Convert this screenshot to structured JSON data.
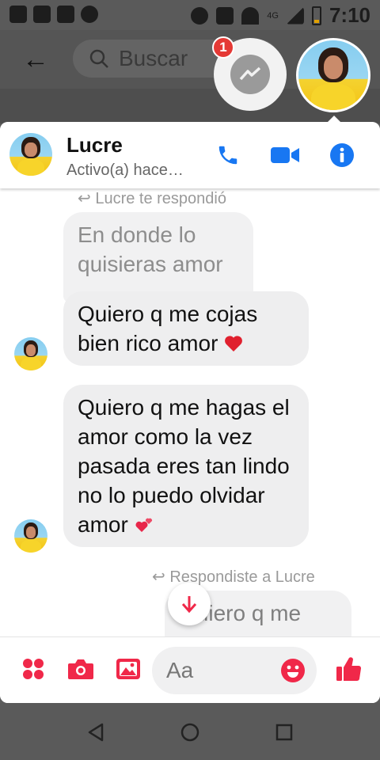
{
  "status_bar": {
    "time": "7:10",
    "network": "4G"
  },
  "background_app": {
    "search_placeholder": "Buscar"
  },
  "chat_heads": {
    "badge_count": "1"
  },
  "chat": {
    "contact_name": "Lucre",
    "contact_status": "Activo(a) hace…",
    "accent_color": "#1877F2"
  },
  "messages": {
    "reply_note_top": "Lucre te respondió",
    "quoted_text": "En donde lo quisieras amor",
    "msg1_text": "Quiero q me cojas bien rico amor",
    "msg2_text": "Quiero q me hagas el amor como la vez pasada eres tan lindo no lo puedo olvidar amor",
    "reply_note_bottom": "Respondiste a Lucre",
    "outgoing_partial": "Quiero q me"
  },
  "composer": {
    "placeholder": "Aa",
    "icons": [
      "grid-menu-icon",
      "camera-icon",
      "gallery-icon",
      "emoji-icon",
      "thumbs-up-icon"
    ],
    "accent_color": "#F02849"
  }
}
